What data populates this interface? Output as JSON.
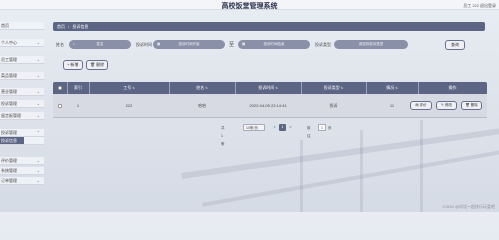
{
  "header": {
    "title": "高校饭堂管理系统",
    "user": "员工 222",
    "logout": "退出登录"
  },
  "sidebar": {
    "items": [
      {
        "label": "首页"
      },
      {
        "label": "个人中心"
      },
      {
        "label": "员工管理"
      },
      {
        "label": "菜品管理"
      },
      {
        "label": "营业管理"
      },
      {
        "label": "投诉管理"
      },
      {
        "label": "留言板管理"
      },
      {
        "label": "投诉管理"
      },
      {
        "label": "投诉信息"
      },
      {
        "label": "评价管理"
      },
      {
        "label": "系统管理"
      },
      {
        "label": "订单管理"
      }
    ]
  },
  "breadcrumb": {
    "home": "首页",
    "separator": "/",
    "current": "投诉信息"
  },
  "search": {
    "label_name": "姓名",
    "placeholder_name": "姓名",
    "label_time": "投诉时间",
    "placeholder_time_start": "投诉时间开始",
    "range_sep": "至",
    "placeholder_time_end": "投诉时间结束",
    "label_type": "投诉类型",
    "placeholder_type": "请选择投诉类型",
    "button": "查询"
  },
  "actions": {
    "add": "新增",
    "delete": "删除"
  },
  "table": {
    "columns": [
      "索引",
      "工号",
      "姓名",
      "投诉时间",
      "投诉类型",
      "情况",
      "操作"
    ],
    "rows": [
      {
        "index": "1",
        "emp_no": "222",
        "name": "哈哈",
        "time": "2022-04-05 22:14:41",
        "type": "投诉",
        "situation": "11"
      }
    ],
    "row_buttons": {
      "reply": "评价",
      "edit": "修改",
      "delete": "删除"
    }
  },
  "pager": {
    "total": "共 1 条",
    "page_size": "10条/页",
    "prev": "<",
    "current_page": "1",
    "next": ">",
    "goto_label": "前往",
    "goto_value": "1",
    "page_unit": "页"
  },
  "watermark": "CSDN @毕设一起快乐玩耍吧"
}
